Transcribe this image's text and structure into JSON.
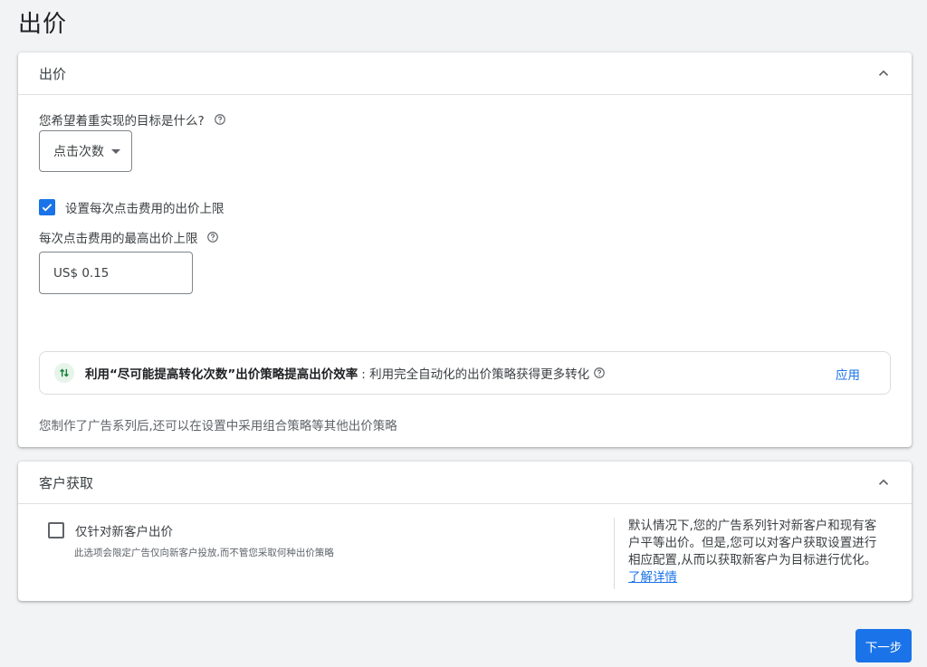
{
  "page": {
    "title": "出价"
  },
  "bidding": {
    "header": "出价",
    "goal_label": "您希望着重实现的目标是什么?",
    "goal_selected": "点击次数",
    "cap_checkbox_label": "设置每次点击费用的出价上限",
    "cap_checked": true,
    "max_cpc_label": "每次点击费用的最高出价上限",
    "max_cpc_value": "US$ 0.15",
    "recommendation": {
      "bold_text": "利用“尽可能提高转化次数”出价策略提高出价效率",
      "text": ":  利用完全自动化的出价策略获得更多转化",
      "apply_label": "应用"
    },
    "footnote": "您制作了广告系列后,还可以在设置中采用组合策略等其他出价策略"
  },
  "acquisition": {
    "header": "客户获取",
    "checkbox_label": "仅针对新客户出价",
    "checkbox_checked": false,
    "checkbox_desc": "此选项会限定广告仅向新客户投放,而不管您采取何种出价策略",
    "help_text": "默认情况下,您的广告系列针对新客户和现有客户平等出价。但是,您可以对客户获取设置进行相应配置,从而以获取新客户为目标进行优化。",
    "learn_more": "了解详情"
  },
  "footer": {
    "next_label": "下一步"
  },
  "colors": {
    "accent": "#1a73e8",
    "success_bg": "#e6f4ea",
    "success": "#188038"
  }
}
